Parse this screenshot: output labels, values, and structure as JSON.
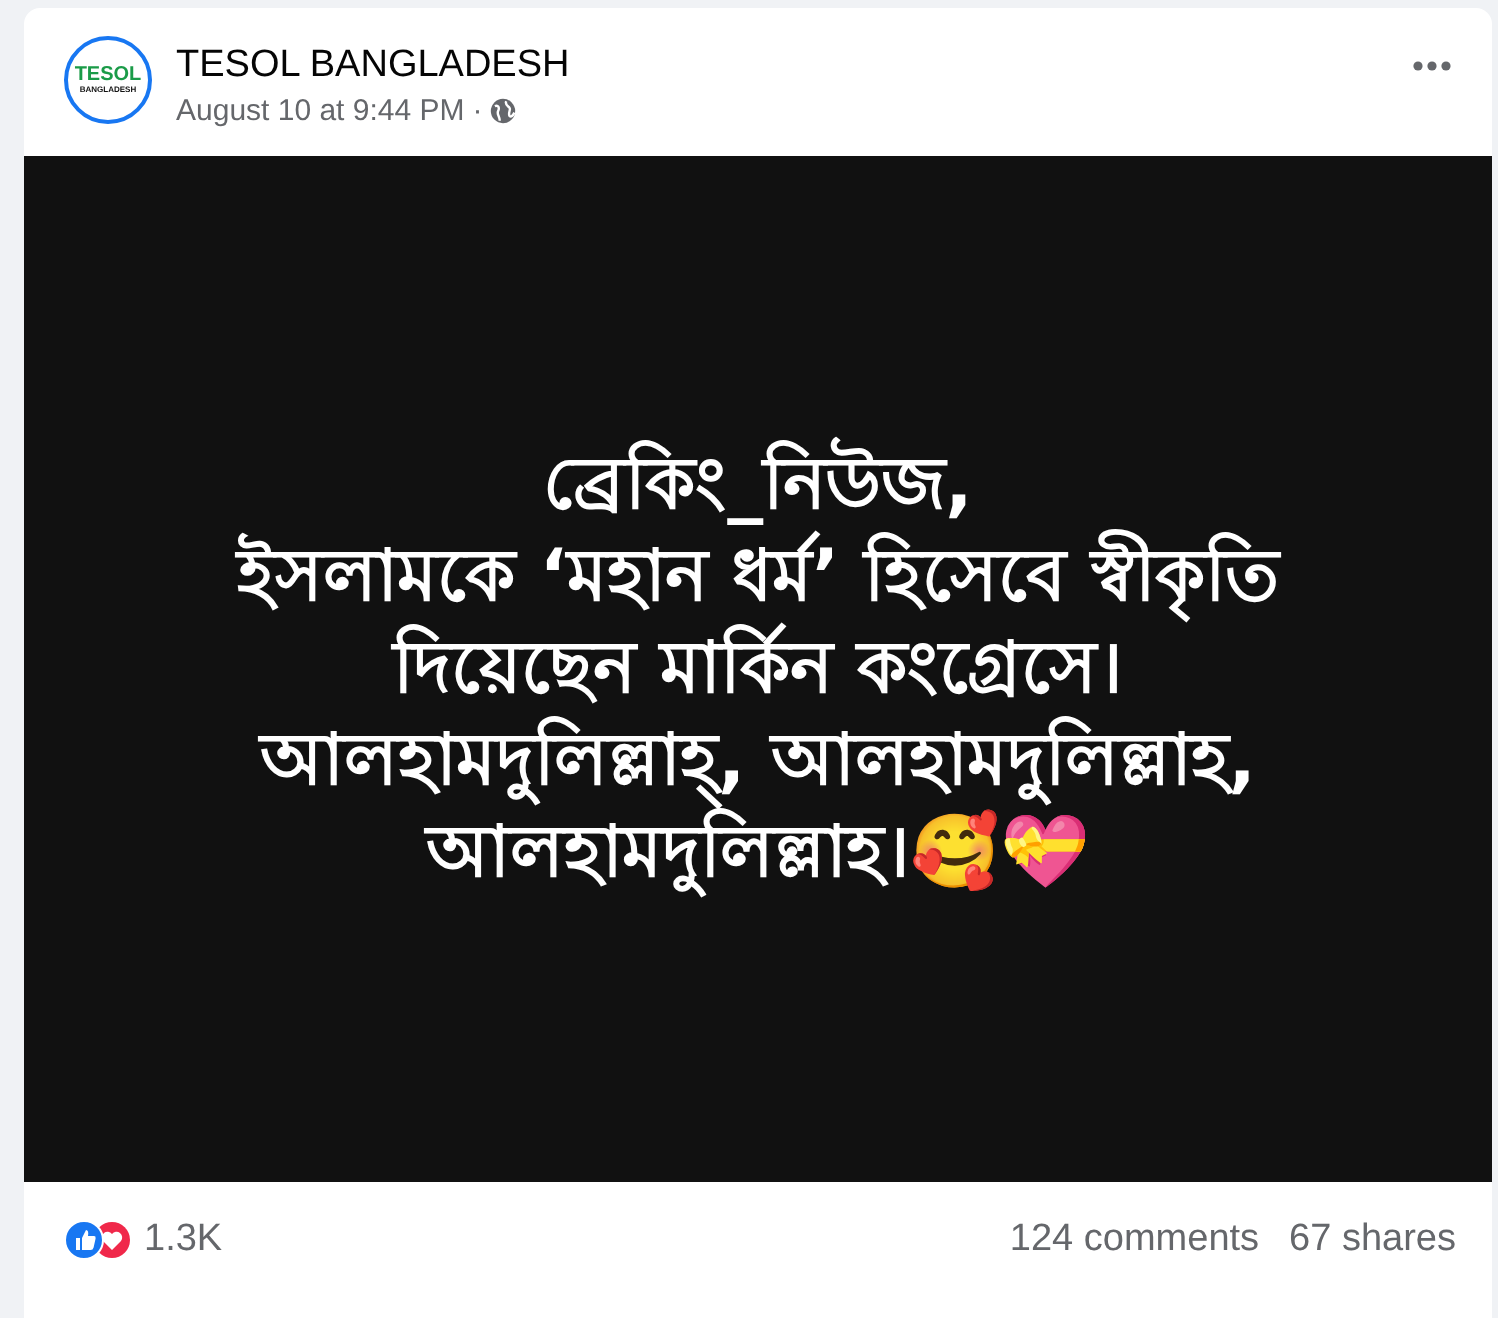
{
  "post": {
    "author": "TESOL BANGLADESH",
    "logo": {
      "top": "TESOL",
      "bottom": "BANGLADESH"
    },
    "timestamp": "August 10 at 9:44 PM",
    "separator": "·"
  },
  "image_text": [
    "ব্রেকিং_নিউজ,",
    "ইসলামকে ‘মহান ধর্ম’ হিসেবে স্বীকৃতি",
    "দিয়েছেন মার্কিন কংগ্রেসে।",
    "আলহামদুলিল্লাহ্, আলহামদুলিল্লাহ,",
    "আলহামদুলিল্লাহ।🥰💝"
  ],
  "footer": {
    "reactions": "1.3K",
    "comments": "124 comments",
    "shares": "67 shares"
  }
}
